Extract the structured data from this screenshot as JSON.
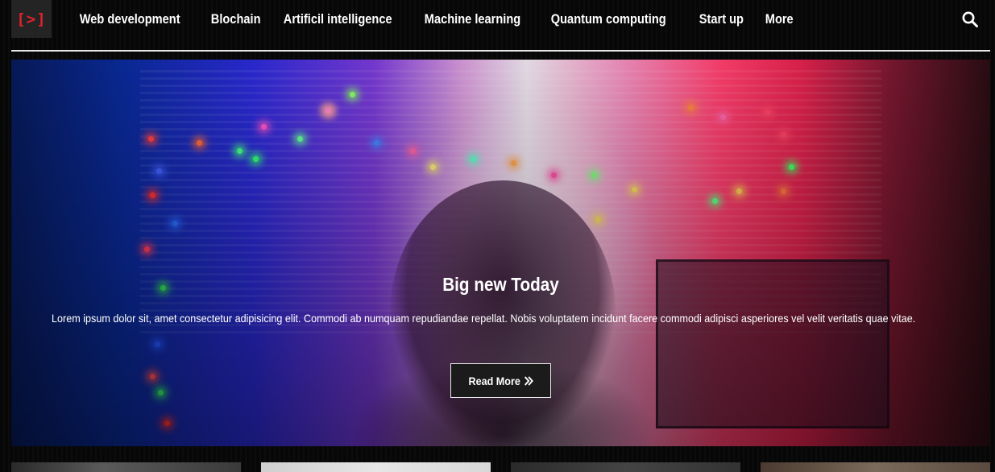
{
  "logo": {
    "text": "[>]",
    "color": "#e0212e"
  },
  "nav": {
    "items": [
      {
        "label": "Web development"
      },
      {
        "label": "Blochain"
      },
      {
        "label": "Artificil intelligence"
      },
      {
        "label": "Machine learning"
      },
      {
        "label": "Quantum computing"
      },
      {
        "label": "Start up"
      },
      {
        "label": "More"
      }
    ],
    "search_icon": "search-icon"
  },
  "hero": {
    "title": "Big new Today",
    "text": "Lorem ipsum dolor sit, amet consectetur adipisicing elit. Commodi ab numquam repudiandae repellat. Nobis voluptatem incidunt facere commodi adipisci asperiores vel velit veritatis quae vitae.",
    "button_label": "Read More",
    "button_icon": "double-chevron-right-icon"
  },
  "colors": {
    "background": "#050505",
    "accent": "#e0212e",
    "button_bg": "#1b1b1b",
    "divider": "#e8e8e8"
  }
}
